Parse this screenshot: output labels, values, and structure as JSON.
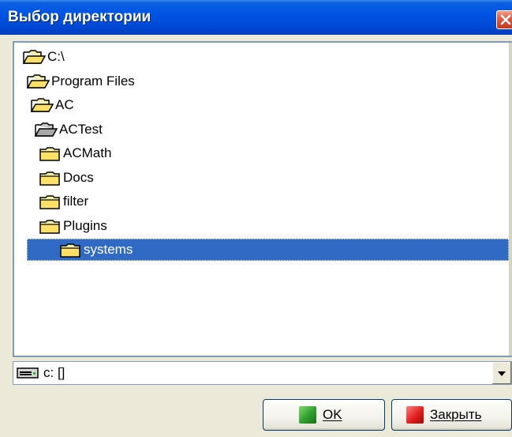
{
  "window": {
    "title": "Выбор директории"
  },
  "tree": {
    "nodes": [
      {
        "label": "C:\\",
        "icon": "folder-open-icon",
        "level": 0,
        "selected": false
      },
      {
        "label": "Program Files",
        "icon": "folder-open-icon",
        "level": 1,
        "selected": false
      },
      {
        "label": "AC",
        "icon": "folder-open-icon",
        "level": 2,
        "selected": false
      },
      {
        "label": "ACTest",
        "icon": "folder-open-grey-icon",
        "level": 3,
        "selected": false
      },
      {
        "label": "ACMath",
        "icon": "folder-closed-icon",
        "level": 4,
        "selected": false
      },
      {
        "label": "Docs",
        "icon": "folder-closed-icon",
        "level": 4,
        "selected": false
      },
      {
        "label": "filter",
        "icon": "folder-closed-icon",
        "level": 4,
        "selected": false
      },
      {
        "label": "Plugins",
        "icon": "folder-closed-icon",
        "level": 4,
        "selected": false
      },
      {
        "label": "systems",
        "icon": "folder-closed-icon",
        "level": 4,
        "selected": true
      }
    ]
  },
  "drive": {
    "value": "c: []",
    "icon": "drive-icon"
  },
  "buttons": {
    "ok_label": "OK",
    "close_label": "Закрыть"
  },
  "colors": {
    "selection": "#316ac5",
    "titlebar": "#0055e5",
    "ok_icon": "#2e9e2e",
    "close_icon": "#e02020",
    "folder": "#ffe680"
  }
}
